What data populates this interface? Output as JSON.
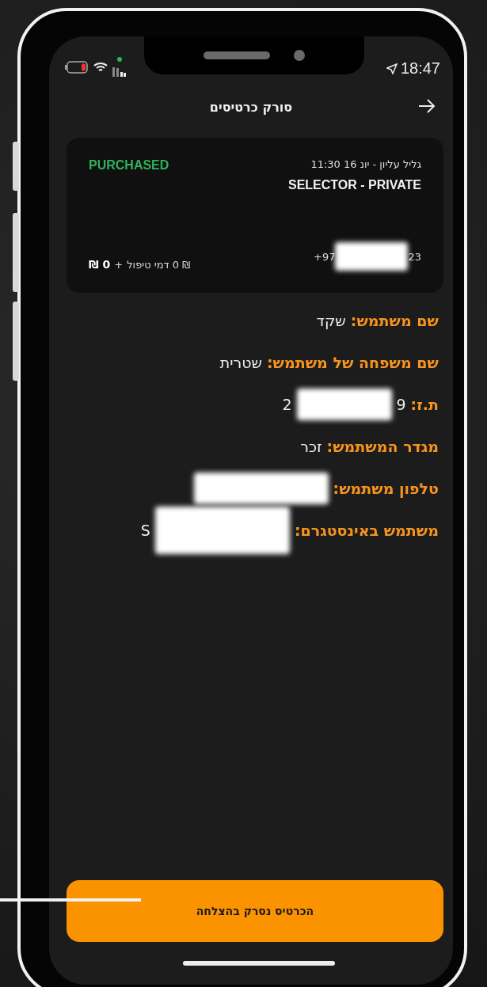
{
  "status_bar": {
    "time": "18:47"
  },
  "header": {
    "title": "סורק כרטיסים"
  },
  "ticket": {
    "event": "גליל עליון - יונ 16 11:30",
    "type": "SELECTOR - PRIVATE",
    "status": "PURCHASED",
    "phone_start": "+97",
    "phone_end": "23",
    "price": "0 ₪",
    "plus": "+",
    "fee": "₪ 0 דמי טיפול"
  },
  "details": [
    {
      "kind": "plain",
      "label": "שם משתמש:",
      "value": "שקד"
    },
    {
      "kind": "plain",
      "label": "שם משפחה של משתמש:",
      "value": "שטרית"
    },
    {
      "kind": "redacted",
      "label": "ת.ז:",
      "visible_start": "9",
      "visible_end": "2"
    },
    {
      "kind": "plain",
      "label": "מגדר המשתמש:",
      "value": "זכר"
    },
    {
      "kind": "redacted",
      "label": "טלפון משתמש:"
    },
    {
      "kind": "redacted",
      "label": "משתמש באינסטגרם:",
      "visible_end": "S"
    }
  ],
  "button": {
    "label": "הכרטיס נסרק בהצלחה"
  }
}
